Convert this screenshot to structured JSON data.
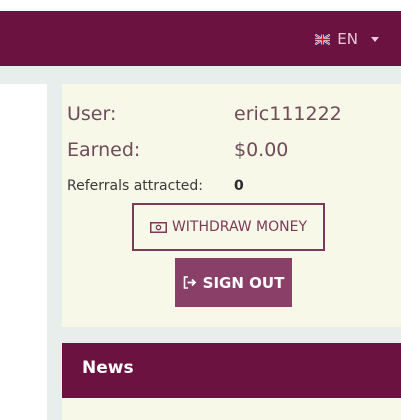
{
  "header": {
    "language": "EN",
    "flag_icon": "uk-flag-icon"
  },
  "account": {
    "user_label": "User:",
    "user_value": "eric111222",
    "earned_label": "Earned:",
    "earned_value": "$0.00",
    "referrals_label": "Referrals attracted:",
    "referrals_value": "0"
  },
  "actions": {
    "withdraw_label": "WITHDRAW MONEY",
    "withdraw_icon": "money-icon",
    "signout_label": "SIGN OUT",
    "signout_icon": "sign-out-icon"
  },
  "news": {
    "title": "News"
  },
  "colors": {
    "brand": "#6b1240",
    "card_bg": "#f8f8e8",
    "button": "#8a3f68"
  }
}
